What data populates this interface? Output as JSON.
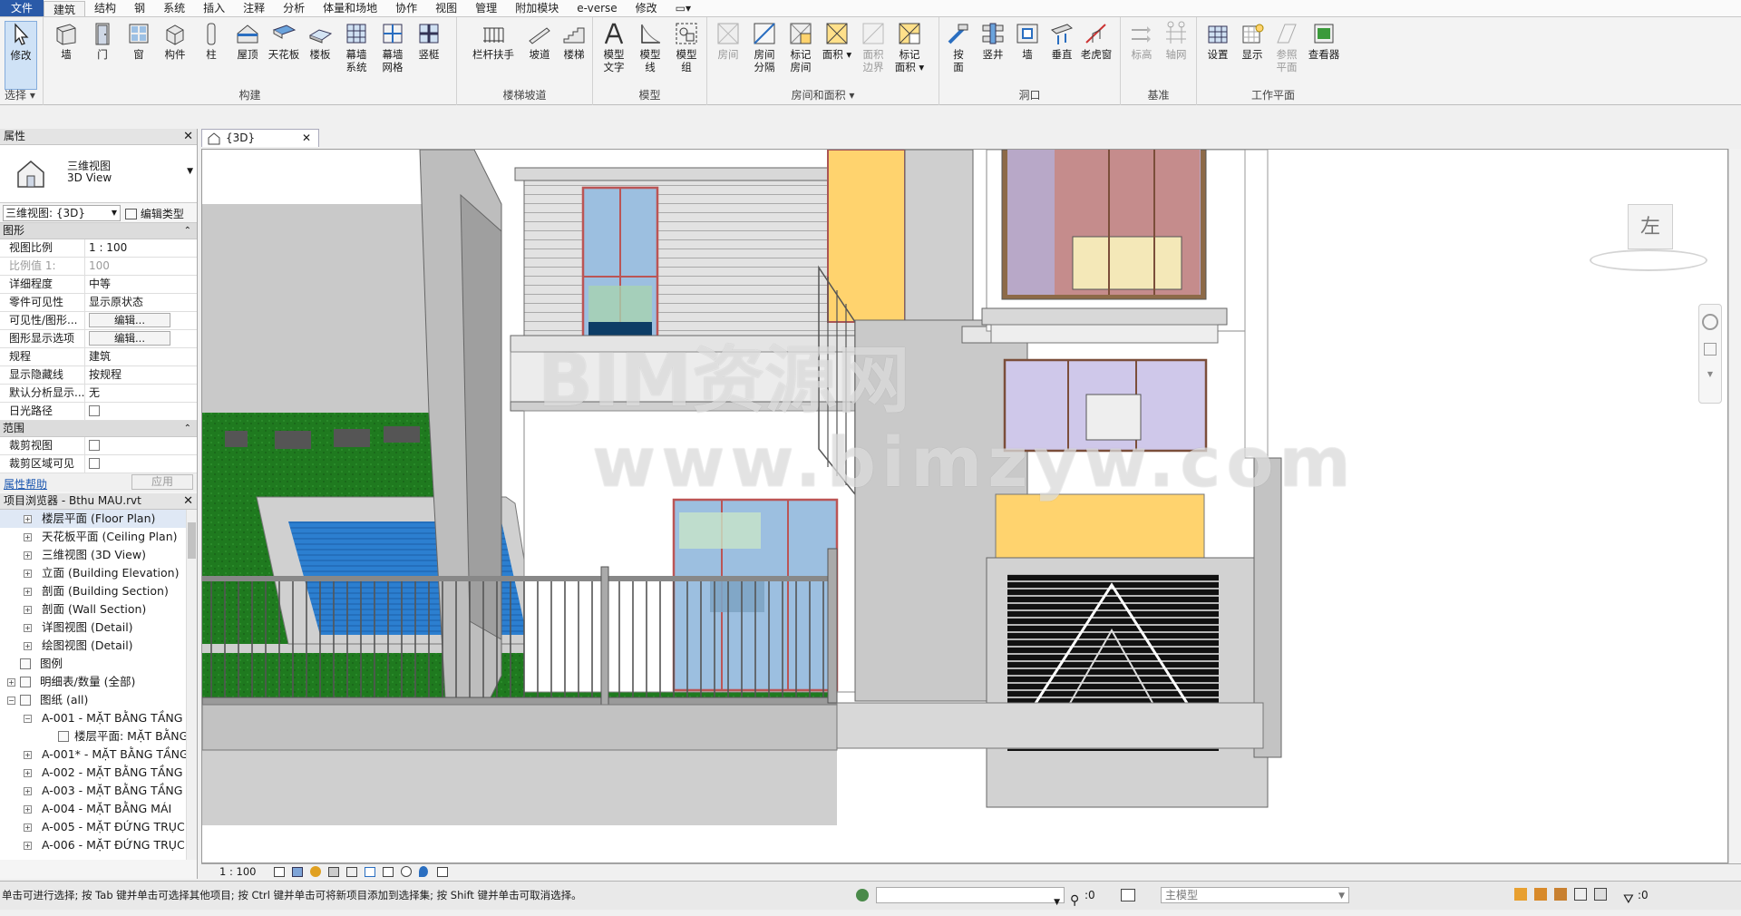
{
  "menubar": {
    "tabs": [
      "文件",
      "建筑",
      "结构",
      "钢",
      "系统",
      "插入",
      "注释",
      "分析",
      "体量和场地",
      "协作",
      "视图",
      "管理",
      "附加模块",
      "e-verse",
      "修改"
    ],
    "active": "建筑"
  },
  "ribbon": {
    "select": {
      "modify": "修改",
      "title": "选择"
    },
    "build": {
      "wall": "墙",
      "door": "门",
      "window": "窗",
      "component": "构件",
      "column": "柱",
      "roof": "屋顶",
      "ceiling": "天花板",
      "floor": "楼板",
      "curtain_system": "幕墙\n系统",
      "curtain_grid": "幕墙\n网格",
      "mullion": "竖梃",
      "title": "构建"
    },
    "circulation": {
      "railing": "栏杆扶手",
      "ramp": "坡道",
      "stair": "楼梯",
      "title": "楼梯坡道"
    },
    "model": {
      "model_text": "模型\n文字",
      "model_line": "模型\n线",
      "model_group": "模型\n组",
      "title": "模型"
    },
    "room": {
      "room": "房间",
      "room_sep": "房间\n分隔",
      "tag_room": "标记\n房间",
      "area": "面积",
      "area_boundary": "面积\n边界",
      "tag_area": "标记\n面积",
      "title": "房间和面积"
    },
    "opening": {
      "by_face": "按\n面",
      "shaft": "竖井",
      "wall": "墙",
      "vertical": "垂直",
      "dormer": "老虎窗",
      "title": "洞口"
    },
    "datum": {
      "level": "标高",
      "grid": "轴网",
      "title": "基准"
    },
    "workplane": {
      "set": "设置",
      "show": "显示",
      "ref_plane": "参照\n平面",
      "viewer": "查看器",
      "title": "工作平面"
    }
  },
  "properties": {
    "title": "属性",
    "type_name_cn": "三维视图",
    "type_name_en": "3D View",
    "instance": "三维视图: {3D}",
    "edit_type": "编辑类型",
    "sections": [
      {
        "name": "图形",
        "rows": [
          {
            "k": "视图比例",
            "v": "1 : 100",
            "grey": false
          },
          {
            "k": "比例值 1:",
            "v": "100",
            "grey": true
          },
          {
            "k": "详细程度",
            "v": "中等",
            "grey": false
          },
          {
            "k": "零件可见性",
            "v": "显示原状态",
            "grey": false
          },
          {
            "k": "可见性/图形...",
            "v": "编辑...",
            "btn": true
          },
          {
            "k": "图形显示选项",
            "v": "编辑...",
            "btn": true
          },
          {
            "k": "规程",
            "v": "建筑",
            "grey": false
          },
          {
            "k": "显示隐藏线",
            "v": "按规程",
            "grey": false
          },
          {
            "k": "默认分析显示...",
            "v": "无",
            "grey": false
          },
          {
            "k": "日光路径",
            "v": "",
            "check": true
          }
        ]
      },
      {
        "name": "范围",
        "rows": [
          {
            "k": "裁剪视图",
            "v": "",
            "check": true
          },
          {
            "k": "裁剪区域可见",
            "v": "",
            "check": true
          }
        ]
      }
    ],
    "help": "属性帮助",
    "apply": "应用"
  },
  "browser": {
    "title": "项目浏览器 - Bthu MAU.rvt",
    "items": [
      {
        "label": "楼层平面 (Floor Plan)",
        "level": 1,
        "exp": "+",
        "hl": true
      },
      {
        "label": "天花板平面 (Ceiling Plan)",
        "level": 1,
        "exp": "+"
      },
      {
        "label": "三维视图 (3D View)",
        "level": 1,
        "exp": "+"
      },
      {
        "label": "立面 (Building Elevation)",
        "level": 1,
        "exp": "+"
      },
      {
        "label": "剖面 (Building Section)",
        "level": 1,
        "exp": "+"
      },
      {
        "label": "剖面 (Wall Section)",
        "level": 1,
        "exp": "+"
      },
      {
        "label": "详图视图 (Detail)",
        "level": 1,
        "exp": "+"
      },
      {
        "label": "绘图视图 (Detail)",
        "level": 1,
        "exp": "+"
      },
      {
        "label": "图例",
        "level": 0,
        "exp": "",
        "icon": true
      },
      {
        "label": "明细表/数量 (全部)",
        "level": 0,
        "exp": "+",
        "icon": true
      },
      {
        "label": "图纸 (all)",
        "level": 0,
        "exp": "−",
        "icon": true
      },
      {
        "label": "A-001 - MẶT BẰNG TẦNG",
        "level": 1,
        "exp": "−"
      },
      {
        "label": "楼层平面: MẶT BẰNG",
        "level": 2,
        "exp": "",
        "icon": true
      },
      {
        "label": "A-001* - MẶT BẰNG TẦNG",
        "level": 1,
        "exp": "+"
      },
      {
        "label": "A-002 - MẶT BẰNG TẦNG",
        "level": 1,
        "exp": "+"
      },
      {
        "label": "A-003 - MẶT BẰNG TẦNG",
        "level": 1,
        "exp": "+"
      },
      {
        "label": "A-004 - MẶT BẰNG MÁI",
        "level": 1,
        "exp": "+"
      },
      {
        "label": "A-005 - MẶT ĐỨNG TRỤC",
        "level": 1,
        "exp": "+"
      },
      {
        "label": "A-006 - MẶT ĐỨNG TRỤC",
        "level": 1,
        "exp": "+"
      }
    ]
  },
  "view": {
    "tab": "{3D}",
    "viewcube_face": "左",
    "scale": "1 : 100",
    "watermark1": "BIM资源网",
    "watermark2": "www.bimzyw.com"
  },
  "status": {
    "hint": "单击可进行选择; 按 Tab 键并单击可选择其他项目; 按 Ctrl 键并单击可将新项目添加到选择集; 按 Shift 键并单击可取消选择。",
    "count1": ":0",
    "model": "主模型",
    "filter": ":0"
  },
  "colors": {
    "accent": "#2a5aa8",
    "glass": "#8fb8d8",
    "grass": "#1f7a1f",
    "pool": "#2c7fd0",
    "yellow": "#ffd36e"
  }
}
